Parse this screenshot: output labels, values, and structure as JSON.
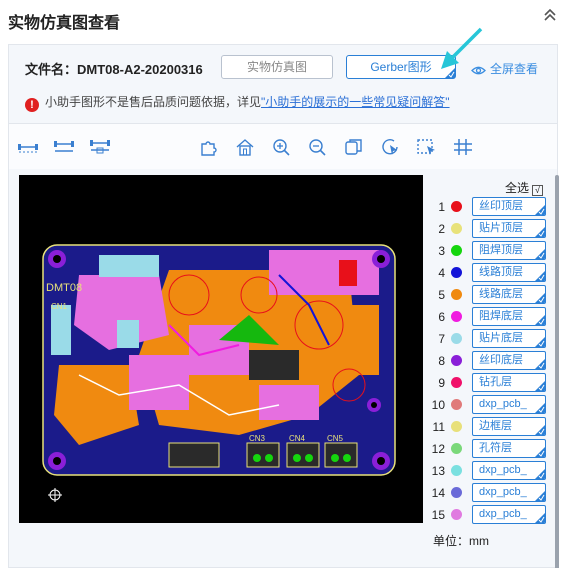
{
  "header": {
    "title": "实物仿真图查看",
    "collapse_icon": "double-chevron-up-icon"
  },
  "file": {
    "label_prefix": "文件名：",
    "name": "DMT08-A2-20200316",
    "sim_button": "实物仿真图",
    "gerber_button": "Gerber图形",
    "fullscreen": "全屏查看"
  },
  "notice": {
    "text": "小助手图形不是售后品质问题依据，详见",
    "link": "\"小助手的展示的一些常见疑问解答\""
  },
  "toolbar": {
    "left_tools": [
      "measure-horizontal-icon",
      "measure-distance-icon",
      "measure-span-icon"
    ],
    "center_tools": [
      "puzzle-icon",
      "home-icon",
      "zoom-in-icon",
      "zoom-out-icon",
      "layers-copy-icon",
      "rotate-cursor-icon",
      "select-area-icon",
      "grid-icon"
    ]
  },
  "board": {
    "silk_label": "DMT08",
    "connectors": [
      "CN3",
      "CN4",
      "CN5"
    ],
    "cn1": "CN1"
  },
  "layers": {
    "select_all": "全选",
    "select_all_mark": "√",
    "items": [
      {
        "num": "1",
        "color": "#e8101a",
        "name": "丝印顶层"
      },
      {
        "num": "2",
        "color": "#e8e27a",
        "name": "贴片顶层"
      },
      {
        "num": "3",
        "color": "#15d60e",
        "name": "阻焊顶层"
      },
      {
        "num": "4",
        "color": "#1414d8",
        "name": "线路顶层"
      },
      {
        "num": "5",
        "color": "#f08a10",
        "name": "线路底层"
      },
      {
        "num": "6",
        "color": "#f01ce0",
        "name": "阻焊底层"
      },
      {
        "num": "7",
        "color": "#9adbe8",
        "name": "贴片底层"
      },
      {
        "num": "8",
        "color": "#8a1fd8",
        "name": "丝印底层"
      },
      {
        "num": "9",
        "color": "#f0106a",
        "name": "钻孔层"
      },
      {
        "num": "10",
        "color": "#e07a7a",
        "name": "dxp_pcb_"
      },
      {
        "num": "11",
        "color": "#e8e07a",
        "name": "边框层"
      },
      {
        "num": "12",
        "color": "#7ad87a",
        "name": "孔符层"
      },
      {
        "num": "13",
        "color": "#7ae0e0",
        "name": "dxp_pcb_"
      },
      {
        "num": "14",
        "color": "#6a6ad8",
        "name": "dxp_pcb_"
      },
      {
        "num": "15",
        "color": "#e07ae0",
        "name": "dxp_pcb_"
      }
    ]
  },
  "unit": "单位：mm"
}
